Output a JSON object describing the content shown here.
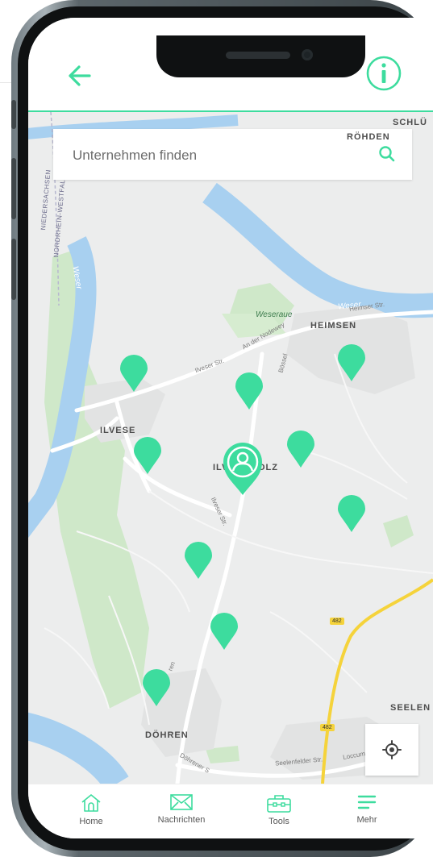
{
  "search": {
    "placeholder": "Unternehmen finden"
  },
  "map_labels": {
    "places": [
      "RÖHDEN",
      "SCHLÜ",
      "HEIMSEN",
      "ILVESE",
      "ILV",
      "OLZ",
      "DÖHREN",
      "SEELEN"
    ],
    "streets": [
      "Ilveser Str.",
      "An der Nodewey",
      "Bössel",
      "Ilveser Str.",
      "Heimser Str.",
      "Seelenfelder Str.",
      "Loccumer",
      "Döhrener S",
      "ren"
    ],
    "water": [
      "Weser",
      "Weser"
    ],
    "green": [
      "Weseraue"
    ],
    "borders": [
      "NIEDERSACHSEN",
      "NORDRHEIN-WESTFAL"
    ],
    "roads": [
      "482",
      "482"
    ]
  },
  "tabs": [
    {
      "label": "Home"
    },
    {
      "label": "Nachrichten"
    },
    {
      "label": "Tools"
    },
    {
      "label": "Mehr"
    }
  ],
  "colors": {
    "accent": "#3ddc9e",
    "water": "#a8d0f0",
    "green": "#cfe8c9",
    "map_bg": "#eceded"
  }
}
